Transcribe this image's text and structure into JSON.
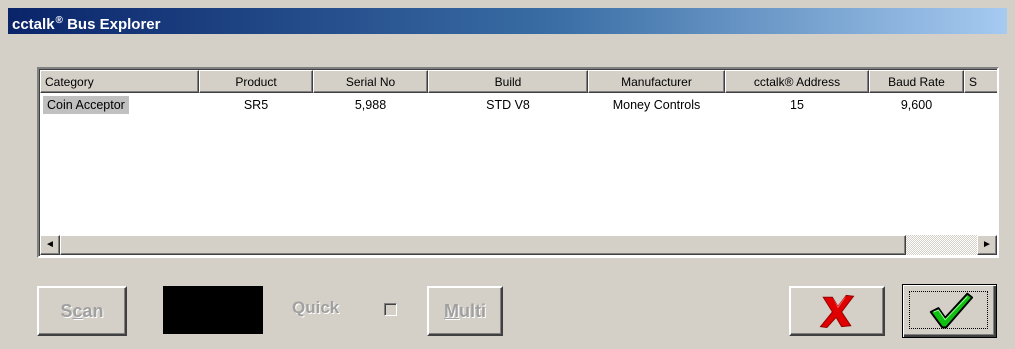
{
  "window": {
    "title": "cctalk",
    "title_mark": "®",
    "title_rest": "Bus Explorer"
  },
  "list": {
    "columns": [
      "Category",
      "Product",
      "Serial No",
      "Build",
      "Manufacturer",
      "cctalk® Address",
      "Baud Rate",
      "S"
    ],
    "rows": [
      [
        "Coin Acceptor",
        "SR5",
        "5,988",
        "STD V8",
        "Money Controls",
        "15",
        "9,600",
        ""
      ]
    ],
    "scroll_left_icon": "◄",
    "scroll_right_icon": "►"
  },
  "controls": {
    "scan_label_u": "S",
    "scan_label_accel": "c",
    "scan_label_rest": "an",
    "quick_label": "Quick",
    "quick_checked": false,
    "multi_label_accel": "M",
    "multi_label_rest": "ulti",
    "cancel_icon": "red-x-icon",
    "ok_icon": "green-check-icon"
  },
  "colors": {
    "title_start": "#0a246a",
    "cancel_red": "#e00000",
    "ok_green": "#10c010"
  }
}
